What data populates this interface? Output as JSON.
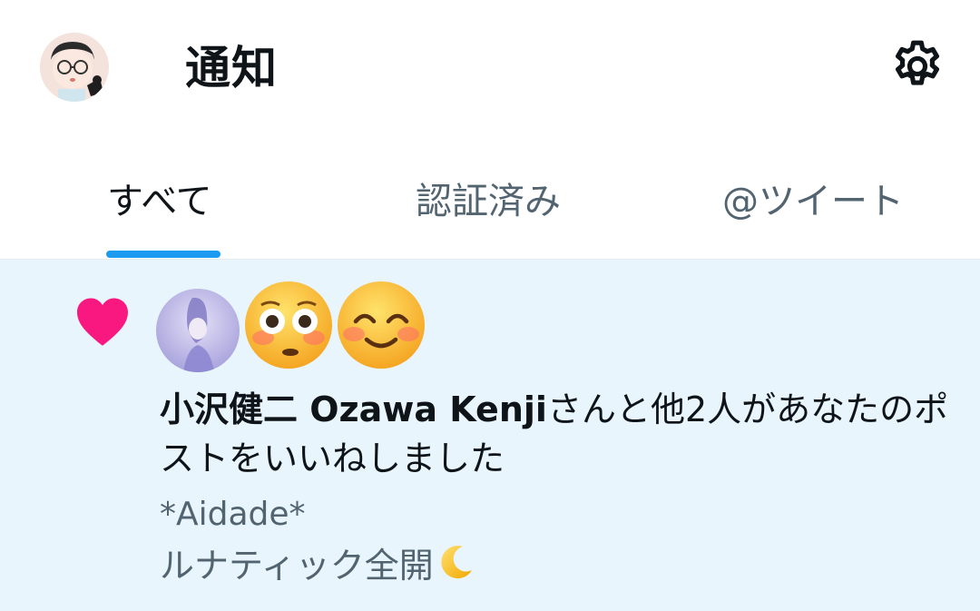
{
  "header": {
    "title": "通知",
    "avatar_icon": "user-avatar",
    "settings_icon": "gear-icon"
  },
  "tabs": [
    {
      "label": "すべて",
      "active": true
    },
    {
      "label": "認証済み",
      "active": false
    },
    {
      "label": "@ツイート",
      "active": false
    }
  ],
  "colors": {
    "accent": "#1d9bf0",
    "heart": "#f91880",
    "notification_bg": "#e8f5fd",
    "primary_text": "#0f1419",
    "secondary_text": "#536471"
  },
  "notification": {
    "type_icon": "heart-icon",
    "likers": [
      "user-avatar",
      "flushed-face-emoji-avatar",
      "smiling-face-emoji-avatar"
    ],
    "liker_name": "小沢健二 Ozawa Kenji",
    "message_rest": "さんと他2人があなたのポストをいいねしました",
    "post_author": "*Aidade*",
    "post_text": "ルナティック全開",
    "post_emoji": "crescent-moon-emoji"
  }
}
